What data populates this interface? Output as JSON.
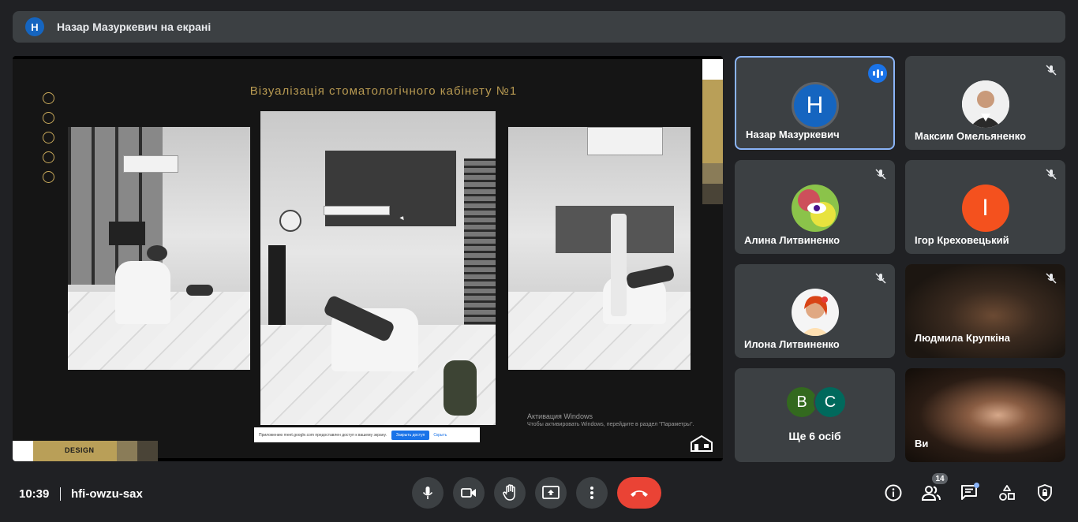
{
  "banner": {
    "avatar_letter": "Н",
    "text": "Назар Мазуркевич на екрані"
  },
  "presentation": {
    "slide_title": "Візуалізація стоматологічного кабінету №1",
    "logo_text": "DESIGN",
    "windows_activation": {
      "line1": "Активация Windows",
      "line2": "Чтобы активировать Windows, перейдите в раздел \"Параметры\"."
    },
    "cookie_notice": {
      "text": "Приложению meet.google.com предоставлен доступ к вашему экрану.",
      "button": "Закрыть доступ",
      "link": "Скрыть"
    }
  },
  "participants": [
    {
      "name": "Назар Мазуркевич",
      "avatar": "Н",
      "avatar_color": "#1565c0",
      "speaking": true
    },
    {
      "name": "Максим Омельяненко",
      "avatar": "photo",
      "muted": true
    },
    {
      "name": "Алина Литвиненко",
      "avatar": "photo",
      "muted": true
    },
    {
      "name": "Ігор Креховецький",
      "avatar": "І",
      "avatar_color": "#f4511e",
      "muted": true
    },
    {
      "name": "Илона Литвиненко",
      "avatar": "photo",
      "muted": true
    },
    {
      "name": "Людмила Крупкіна",
      "avatar": "camera",
      "muted": true
    },
    {
      "name": "Ще 6 осіб",
      "avatars": [
        "В",
        "С"
      ],
      "avatar_colors": [
        "#33691e",
        "#00695c"
      ]
    },
    {
      "name": "Ви",
      "avatar": "camera"
    }
  ],
  "bottom_bar": {
    "time": "10:39",
    "meeting_code": "hfi-owzu-sax",
    "people_count": "14"
  }
}
